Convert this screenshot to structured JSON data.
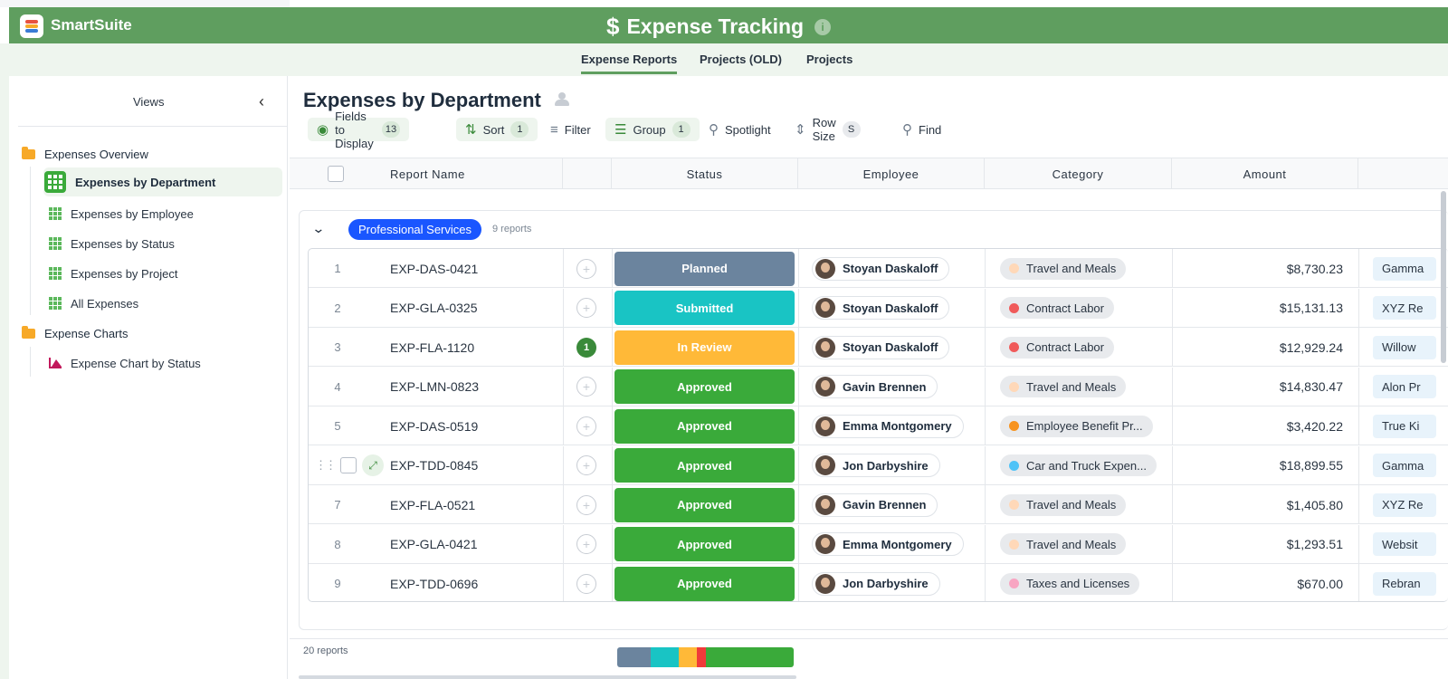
{
  "app": {
    "brand": "SmartSuite",
    "title": "Expense Tracking",
    "title_icon": "$"
  },
  "tabs": [
    {
      "label": "Expense Reports",
      "active": true
    },
    {
      "label": "Projects (OLD)",
      "active": false
    },
    {
      "label": "Projects",
      "active": false
    }
  ],
  "sidebar": {
    "title": "Views",
    "folders": [
      {
        "label": "Expenses Overview"
      },
      {
        "label": "Expense Charts"
      }
    ],
    "views": [
      {
        "label": "Expenses by Department",
        "active": true,
        "icon": "grid-view-icon"
      },
      {
        "label": "Expenses by Employee",
        "icon": "grid-view-icon"
      },
      {
        "label": "Expenses by Status",
        "icon": "grid-view-icon"
      },
      {
        "label": "Expenses by Project",
        "icon": "grid-view-icon"
      },
      {
        "label": "All Expenses",
        "icon": "grid-view-icon"
      },
      {
        "label": "Expense Chart by Status",
        "icon": "chart-icon"
      }
    ]
  },
  "view": {
    "title": "Expenses by Department"
  },
  "toolbar": {
    "fields_label": "Fields to Display",
    "fields_count": "13",
    "sort_label": "Sort",
    "sort_count": "1",
    "filter_label": "Filter",
    "group_label": "Group",
    "group_count": "1",
    "spotlight_label": "Spotlight",
    "rowsize_label": "Row Size",
    "rowsize_value": "S",
    "find_label": "Find"
  },
  "columns": {
    "report_name": "Report Name",
    "status": "Status",
    "employee": "Employee",
    "category": "Category",
    "amount": "Amount"
  },
  "group": {
    "label": "Professional Services",
    "count_text": "9 reports",
    "color": "#1a56ff"
  },
  "status_colors": {
    "Planned": "#6b849e",
    "Submitted": "#19c4c4",
    "In Review": "#ffb938",
    "Approved": "#3aaa3a"
  },
  "rows": [
    {
      "num": "1",
      "name": "EXP-DAS-0421",
      "comments": "",
      "status": "Planned",
      "employee": "Stoyan Daskaloff",
      "category": "Travel and Meals",
      "cat_color": "#ffd8b8",
      "amount": "$8,730.23",
      "project": "Gamma"
    },
    {
      "num": "2",
      "name": "EXP-GLA-0325",
      "comments": "",
      "status": "Submitted",
      "employee": "Stoyan Daskaloff",
      "category": "Contract Labor",
      "cat_color": "#f05a5a",
      "amount": "$15,131.13",
      "project": "XYZ Re"
    },
    {
      "num": "3",
      "name": "EXP-FLA-1120",
      "comments": "1",
      "status": "In Review",
      "employee": "Stoyan Daskaloff",
      "category": "Contract Labor",
      "cat_color": "#f05a5a",
      "amount": "$12,929.24",
      "project": "Willow"
    },
    {
      "num": "4",
      "name": "EXP-LMN-0823",
      "comments": "",
      "status": "Approved",
      "employee": "Gavin Brennen",
      "category": "Travel and Meals",
      "cat_color": "#ffd8b8",
      "amount": "$14,830.47",
      "project": "Alon Pr"
    },
    {
      "num": "5",
      "name": "EXP-DAS-0519",
      "comments": "",
      "status": "Approved",
      "employee": "Emma Montgomery",
      "category": "Employee Benefit Pr...",
      "cat_color": "#f7931e",
      "amount": "$3,420.22",
      "project": "True Ki"
    },
    {
      "num": "",
      "name": "EXP-TDD-0845",
      "comments": "",
      "status": "Approved",
      "employee": "Jon Darbyshire",
      "category": "Car and Truck Expen...",
      "cat_color": "#4fc3f7",
      "amount": "$18,899.55",
      "project": "Gamma",
      "hover": true
    },
    {
      "num": "7",
      "name": "EXP-FLA-0521",
      "comments": "",
      "status": "Approved",
      "employee": "Gavin Brennen",
      "category": "Travel and Meals",
      "cat_color": "#ffd8b8",
      "amount": "$1,405.80",
      "project": "XYZ Re"
    },
    {
      "num": "8",
      "name": "EXP-GLA-0421",
      "comments": "",
      "status": "Approved",
      "employee": "Emma Montgomery",
      "category": "Travel and Meals",
      "cat_color": "#ffd8b8",
      "amount": "$1,293.51",
      "project": "Websit"
    },
    {
      "num": "9",
      "name": "EXP-TDD-0696",
      "comments": "",
      "status": "Approved",
      "employee": "Jon Darbyshire",
      "category": "Taxes and Licenses",
      "cat_color": "#f8a5c2",
      "amount": "$670.00",
      "project": "Rebran"
    }
  ],
  "footer": {
    "count_text": "20 reports",
    "status_summary": [
      {
        "status": "Planned",
        "share": 0.19
      },
      {
        "status": "Submitted",
        "share": 0.16
      },
      {
        "status": "In Review",
        "share": 0.1
      },
      {
        "status": "Contract",
        "share": 0.05,
        "color": "#f03a3a"
      },
      {
        "status": "Approved",
        "share": 0.5
      }
    ]
  }
}
